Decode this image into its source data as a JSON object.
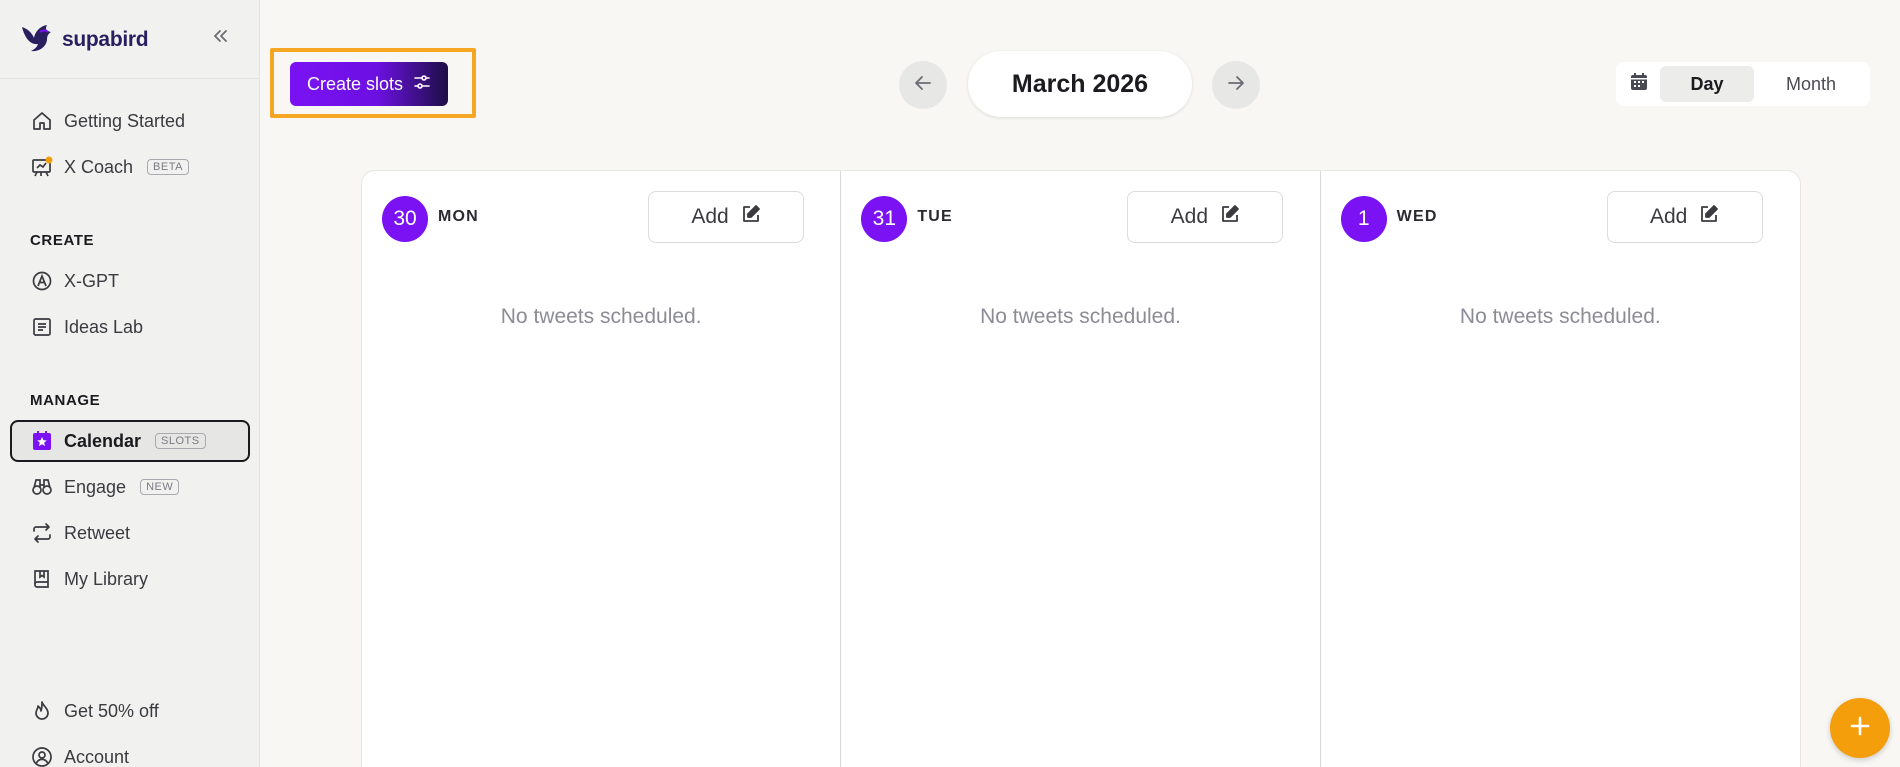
{
  "brand": {
    "name": "supabird"
  },
  "sidebar": {
    "top_items": [
      {
        "label": "Getting Started",
        "icon": "home-icon"
      },
      {
        "label": "X Coach",
        "badge": "BETA",
        "icon": "coach-icon"
      }
    ],
    "create_section": {
      "title": "CREATE",
      "items": [
        {
          "label": "X-GPT",
          "icon": "ai-icon"
        },
        {
          "label": "Ideas Lab",
          "icon": "notes-icon"
        }
      ]
    },
    "manage_section": {
      "title": "MANAGE",
      "items": [
        {
          "label": "Calendar",
          "badge": "SLOTS",
          "icon": "calendar-star-icon",
          "active": true
        },
        {
          "label": "Engage",
          "badge": "NEW",
          "icon": "binoculars-icon"
        },
        {
          "label": "Retweet",
          "icon": "retweet-icon"
        },
        {
          "label": "My Library",
          "icon": "library-icon"
        }
      ]
    },
    "bottom_items": [
      {
        "label": "Get 50% off",
        "icon": "flame-icon"
      },
      {
        "label": "Account",
        "icon": "user-icon"
      }
    ]
  },
  "toolbar": {
    "create_slots_label": "Create slots",
    "month_label": "March 2026",
    "view_day": "Day",
    "view_month": "Month",
    "active_view": "Day"
  },
  "calendar": {
    "days": [
      {
        "num": "30",
        "name": "MON",
        "add_label": "Add",
        "empty_text": "No tweets scheduled."
      },
      {
        "num": "31",
        "name": "TUE",
        "add_label": "Add",
        "empty_text": "No tweets scheduled."
      },
      {
        "num": "1",
        "name": "WED",
        "add_label": "Add",
        "empty_text": "No tweets scheduled."
      }
    ]
  },
  "colors": {
    "accent": "#7a12f4",
    "highlight": "#f5a623",
    "fab": "#f59e0b"
  }
}
